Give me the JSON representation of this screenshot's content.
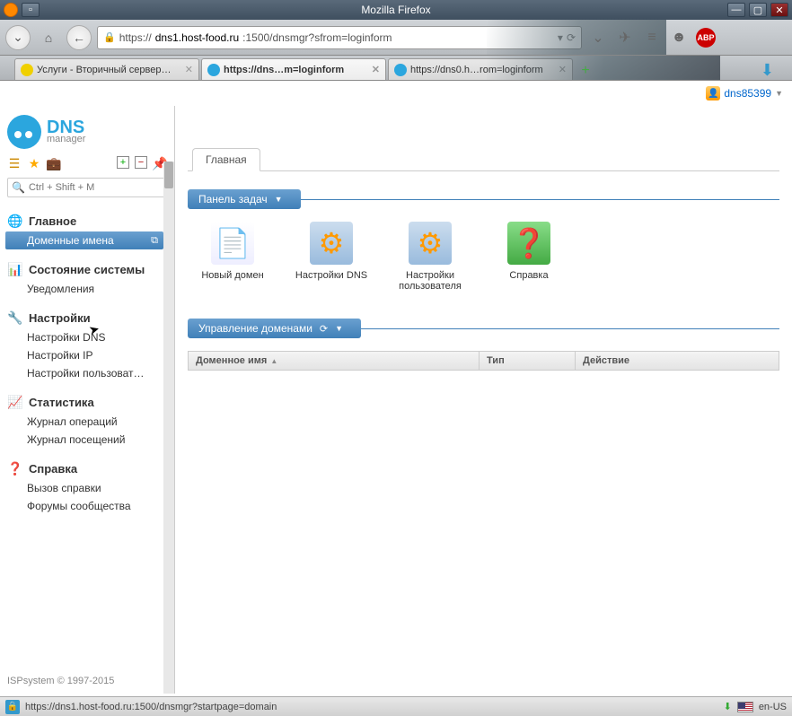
{
  "window": {
    "title": "Mozilla Firefox"
  },
  "url_bar": {
    "prefix": "https://",
    "host": "dns1.host-food.ru",
    "path": ":1500/dnsmgr?sfrom=loginform"
  },
  "tabs": [
    {
      "label": "Услуги - Вторичный сервер…",
      "active": false,
      "color": "#f0d000"
    },
    {
      "label": "https://dns…m=loginform",
      "active": true,
      "color": "#2ba6de"
    },
    {
      "label": "https://dns0.h…rom=loginform",
      "active": false,
      "color": "#2ba6de"
    }
  ],
  "toolbar_icons": [
    "pocket",
    "send",
    "menu",
    "smile",
    "abp"
  ],
  "user": {
    "name": "dns85399"
  },
  "logo": {
    "line1": "DNS",
    "line2": "manager"
  },
  "search": {
    "placeholder": "Ctrl + Shift + M"
  },
  "sidebar": {
    "sections": [
      {
        "icon": "🌐",
        "color": "#f0a020",
        "title": "Главное",
        "items": [
          {
            "label": "Доменные имена",
            "selected": true
          }
        ]
      },
      {
        "icon": "📊",
        "color": "#4080c0",
        "title": "Состояние системы",
        "items": [
          {
            "label": "Уведомления"
          }
        ]
      },
      {
        "icon": "🔧",
        "color": "#4080c0",
        "title": "Настройки",
        "items": [
          {
            "label": "Настройки DNS"
          },
          {
            "label": "Настройки IP"
          },
          {
            "label": "Настройки пользоват…"
          }
        ]
      },
      {
        "icon": "📈",
        "color": "#40a040",
        "title": "Статистика",
        "items": [
          {
            "label": "Журнал операций"
          },
          {
            "label": "Журнал посещений"
          }
        ]
      },
      {
        "icon": "❓",
        "color": "#40a040",
        "title": "Справка",
        "items": [
          {
            "label": "Вызов справки"
          },
          {
            "label": "Форумы сообщества"
          }
        ]
      }
    ]
  },
  "main_tab": "Главная",
  "panel1": {
    "title": "Панель задач"
  },
  "big_icons": [
    {
      "label": "Новый домен",
      "glyph": "📄",
      "accent": "#4a4"
    },
    {
      "label": "Настройки DNS",
      "glyph": "⚙",
      "accent": "#f90"
    },
    {
      "label": "Настройки пользователя",
      "glyph": "⚙",
      "accent": "#f90"
    },
    {
      "label": "Справка",
      "glyph": "❓",
      "accent": "#4a4"
    }
  ],
  "panel2": {
    "title": "Управление доменами"
  },
  "table": {
    "cols": [
      "Доменное имя",
      "Тип",
      "Действие"
    ]
  },
  "footer": "ISPsystem © 1997-2015",
  "status": {
    "url": "https://dns1.host-food.ru:1500/dnsmgr?startpage=domain",
    "lang": "en-US"
  }
}
